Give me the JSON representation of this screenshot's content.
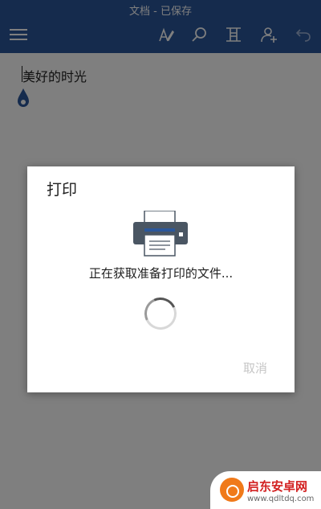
{
  "app": {
    "window_title": "文档 - 已保存",
    "document_text": "美好的时光",
    "toolbar": {
      "icons": [
        "hamburger-menu-icon",
        "draw-pen-icon",
        "search-icon",
        "crop-layout-icon",
        "add-person-icon",
        "undo-icon"
      ]
    }
  },
  "dialog": {
    "title": "打印",
    "status_text": "正在获取准备打印的文件...",
    "cancel_label": "取消",
    "icon": "printer-icon"
  },
  "watermark": {
    "name": "启东安卓网",
    "url": "www.qdltdq.com"
  },
  "colors": {
    "appbar": "#2b579a",
    "printer_body": "#4a5663",
    "printer_paper": "#2b579a",
    "watermark_logo": "#f07a1a",
    "watermark_text": "#d21f1f"
  }
}
